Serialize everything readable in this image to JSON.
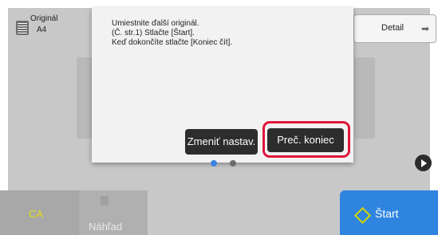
{
  "original": {
    "label": "Originál",
    "size": "A4",
    "icon": "document-icon"
  },
  "detail": {
    "label": "Detail",
    "icon": "➡"
  },
  "dialog": {
    "line1": "Umiestnite ďalší originál.",
    "line2": "(Č. str.1) Stlačte [Štart].",
    "line3": "Keď dokončíte stlačte [Koniec čít].",
    "change_label": "Zmeniť nastav.",
    "end_label": "Preč. koniec"
  },
  "pager": {
    "active_page": 1,
    "total_pages": 2
  },
  "bottom": {
    "ca_label": "CA",
    "preview_label": "Náhľad",
    "start_label": "Štart"
  },
  "colors": {
    "accent": "#2f84e0",
    "highlight": "#e0153a",
    "ca_text": "#e2dc13"
  }
}
